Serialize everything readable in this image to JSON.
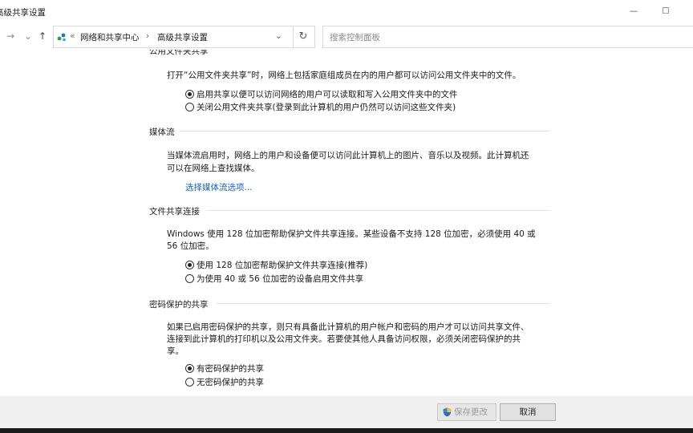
{
  "window": {
    "title": "高级共享设置",
    "minimize": "—",
    "maximize": "☐"
  },
  "nav": {
    "back": "←",
    "forward": "→",
    "recent": "⌄",
    "up": "↑",
    "dropdown": "⌄",
    "refresh": "↻"
  },
  "address": {
    "chevrons": "«",
    "crumb1": "网络和共享中心",
    "separator": "›",
    "crumb2": "高级共享设置"
  },
  "search": {
    "placeholder": "搜索控制面板"
  },
  "colors": {
    "link": "#1a5fb4",
    "shield_blue": "#2f6fb7",
    "shield_yellow": "#f2c12e"
  },
  "public_folder": {
    "title": "公用文件夹共享",
    "desc": "打开“公用文件夹共享”时，网络上包括家庭组成员在内的用户都可以访问公用文件夹中的文件。",
    "options": [
      "启用共享以便可以访问网络的用户可以读取和写入公用文件夹中的文件",
      "关闭公用文件夹共享(登录到此计算机的用户仍然可以访问这些文件夹)"
    ]
  },
  "media": {
    "title": "媒体流",
    "desc_line1": "当媒体流启用时，网络上的用户和设备便可以访问此计算机上的图片、音乐以及视频。此计算机还",
    "desc_line2": "可以在网络上查找媒体。",
    "link": "选择媒体流选项..."
  },
  "file_sharing": {
    "title": "文件共享连接",
    "desc_line1": "Windows 使用 128 位加密帮助保护文件共享连接。某些设备不支持 128 位加密，必须使用 40 或",
    "desc_line2": "56 位加密。",
    "options": [
      "使用 128 位加密帮助保护文件共享连接(推荐)",
      "为使用 40 或 56 位加密的设备启用文件共享"
    ]
  },
  "password": {
    "title": "密码保护的共享",
    "desc_line1": "如果已启用密码保护的共享，则只有具备此计算机的用户帐户和密码的用户才可以访问共享文件、",
    "desc_line2": "连接到此计算机的打印机以及公用文件夹。若要使其他人具备访问权限，必须关闭密码保护的共",
    "desc_line3": "享。",
    "options": [
      "有密码保护的共享",
      "无密码保护的共享"
    ]
  },
  "footer": {
    "save": "保存更改",
    "cancel": "取消"
  }
}
